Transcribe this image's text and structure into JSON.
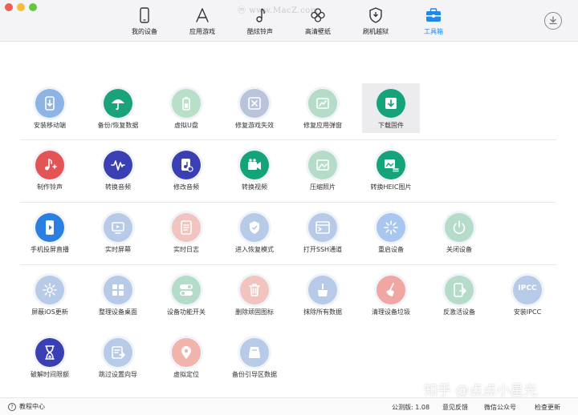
{
  "watermark": "ⓜ www.MacZ.com",
  "nav": [
    {
      "label": "我的设备",
      "icon": "phone-icon"
    },
    {
      "label": "应用游戏",
      "icon": "app-store-icon"
    },
    {
      "label": "酷炫铃声",
      "icon": "music-note-icon"
    },
    {
      "label": "高清壁纸",
      "icon": "flower-icon"
    },
    {
      "label": "刷机越狱",
      "icon": "shield-icon"
    },
    {
      "label": "工具箱",
      "icon": "toolbox-icon",
      "active": true
    }
  ],
  "rows": [
    [
      {
        "label": "安装移动端",
        "icon": "install-mobile-icon",
        "color": "#8eb4e6"
      },
      {
        "label": "备份/恢复数据",
        "icon": "umbrella-icon",
        "color": "#1aa37a"
      },
      {
        "label": "虚拟U盘",
        "icon": "usb-battery-icon",
        "color": "#b8dfc7"
      },
      {
        "label": "修复游戏失效",
        "icon": "repair-game-icon",
        "color": "#b9c3db"
      },
      {
        "label": "修复应用弹窗",
        "icon": "repair-popup-icon",
        "color": "#b5dbc9"
      },
      {
        "label": "下载固件",
        "icon": "download-firmware-icon",
        "color": "#15a37a"
      }
    ],
    [
      {
        "label": "制作铃声",
        "icon": "ringtone-icon",
        "color": "#e55454"
      },
      {
        "label": "转换音频",
        "icon": "audio-wave-icon",
        "color": "#3a3fb4"
      },
      {
        "label": "修改音频",
        "icon": "edit-audio-icon",
        "color": "#3a3fb4"
      },
      {
        "label": "转换视频",
        "icon": "video-camera-icon",
        "color": "#15a37a"
      },
      {
        "label": "压缩照片",
        "icon": "compress-photo-icon",
        "color": "#b5dbc9"
      },
      {
        "label": "转换HEIC图片",
        "icon": "heic-image-icon",
        "color": "#15a37a"
      }
    ],
    [
      {
        "label": "手机投屏直播",
        "icon": "screen-cast-icon",
        "color": "#2b7fe0"
      },
      {
        "label": "实时屏幕",
        "icon": "realtime-screen-icon",
        "color": "#b7cbe8"
      },
      {
        "label": "实时日志",
        "icon": "log-icon",
        "color": "#f1c4bf"
      },
      {
        "label": "进入恢复模式",
        "icon": "recovery-shield-icon",
        "color": "#b7cbe8"
      },
      {
        "label": "打开SSH通道",
        "icon": "ssh-icon",
        "color": "#b7cbe8"
      },
      {
        "label": "重启设备",
        "icon": "restart-icon",
        "color": "#a9c6ef"
      },
      {
        "label": "关闭设备",
        "icon": "power-icon",
        "color": "#b5dbc9"
      }
    ],
    [
      {
        "label": "屏蔽iOS更新",
        "icon": "gear-icon",
        "color": "#b7cbe8"
      },
      {
        "label": "整理设备桌面",
        "icon": "grid-icon",
        "color": "#b7cbe8"
      },
      {
        "label": "设备功能开关",
        "icon": "toggle-icon",
        "color": "#b5dbc9"
      },
      {
        "label": "删除顽固图标",
        "icon": "trash-icon",
        "color": "#f1c4bf"
      },
      {
        "label": "抹除所有数据",
        "icon": "erase-icon",
        "color": "#b7cbe8"
      },
      {
        "label": "清理设备垃圾",
        "icon": "broom-icon",
        "color": "#f0a7a4"
      },
      {
        "label": "反激活设备",
        "icon": "deactivate-icon",
        "color": "#b5dbc9"
      },
      {
        "label": "安装IPCC",
        "icon": "ipcc-icon",
        "color": "#b7cbe8",
        "text": "IPCC"
      }
    ],
    [
      {
        "label": "破解时间限额",
        "icon": "hourglass-icon",
        "color": "#3a3fb4"
      },
      {
        "label": "跳过设置向导",
        "icon": "skip-guide-icon",
        "color": "#b7cbe8"
      },
      {
        "label": "虚拟定位",
        "icon": "location-pin-icon",
        "color": "#f1b3ac"
      },
      {
        "label": "备份引导区数据",
        "icon": "backup-boot-icon",
        "color": "#b7cbe8"
      }
    ]
  ],
  "status": {
    "help": "教程中心",
    "version": "公测版: 1.08",
    "feedback": "意见反馈",
    "wechat": "微信公众号",
    "update": "检查更新"
  },
  "overlay_watermark": "知乎 @点点小星光"
}
